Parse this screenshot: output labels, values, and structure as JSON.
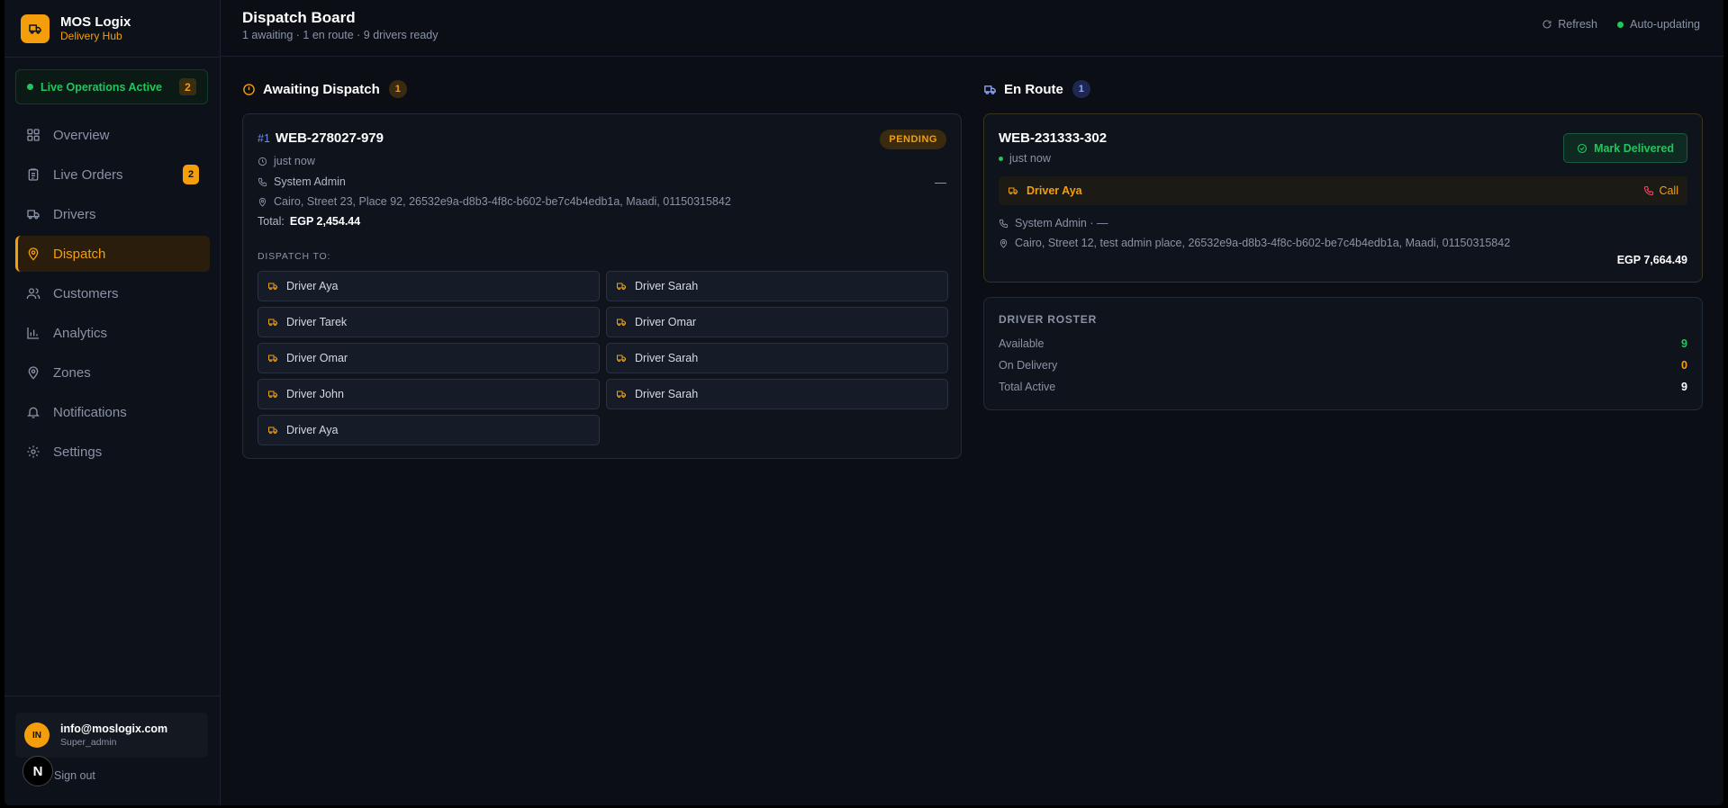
{
  "brand": {
    "name": "MOS Logix",
    "subtitle": "Delivery Hub"
  },
  "live": {
    "label": "Live Operations Active",
    "count": "2"
  },
  "nav": [
    {
      "label": "Overview",
      "icon": "grid-icon"
    },
    {
      "label": "Live Orders",
      "icon": "clipboard-icon",
      "badge": "2"
    },
    {
      "label": "Drivers",
      "icon": "truck-icon"
    },
    {
      "label": "Dispatch",
      "icon": "map-pin-icon",
      "active": true
    },
    {
      "label": "Customers",
      "icon": "users-icon"
    },
    {
      "label": "Analytics",
      "icon": "bar-chart-icon"
    },
    {
      "label": "Zones",
      "icon": "map-pin-icon"
    },
    {
      "label": "Notifications",
      "icon": "bell-icon"
    },
    {
      "label": "Settings",
      "icon": "gear-icon"
    }
  ],
  "user": {
    "initials": "IN",
    "email": "info@moslogix.com",
    "role": "Super_admin",
    "signout": "Sign out"
  },
  "header": {
    "title": "Dispatch Board",
    "subtitle": "1 awaiting · 1 en route · 9 drivers ready",
    "refresh": "Refresh",
    "auto": "Auto-updating"
  },
  "awaiting": {
    "title": "Awaiting Dispatch",
    "count": "1",
    "order": {
      "index": "#1",
      "id": "WEB-278027-979",
      "status": "PENDING",
      "time": "just now",
      "customer": "System Admin",
      "phone_placeholder": "—",
      "address": "Cairo, Street 23, Place 92, 26532e9a-d8b3-4f8c-b602-be7c4b4edb1a, Maadi, 01150315842",
      "total_label": "Total:",
      "total": "EGP 2,454.44",
      "dispatch_label": "DISPATCH TO:",
      "drivers": [
        "Driver Aya",
        "Driver Sarah",
        "Driver Tarek",
        "Driver Omar",
        "Driver Omar",
        "Driver Sarah",
        "Driver John",
        "Driver Sarah",
        "Driver Aya"
      ]
    }
  },
  "enroute": {
    "title": "En Route",
    "count": "1",
    "order": {
      "id": "WEB-231333-302",
      "time": "just now",
      "mark_label": "Mark Delivered",
      "driver": "Driver Aya",
      "call_label": "Call",
      "customer": "System Admin · —",
      "address": "Cairo, Street 12, test admin place, 26532e9a-d8b3-4f8c-b602-be7c4b4edb1a, Maadi, 01150315842",
      "total": "EGP 7,664.49"
    }
  },
  "roster": {
    "title": "DRIVER ROSTER",
    "rows": [
      {
        "label": "Available",
        "value": "9",
        "color": "#22c55e"
      },
      {
        "label": "On Delivery",
        "value": "0",
        "color": "#f59e0b"
      },
      {
        "label": "Total Active",
        "value": "9",
        "color": "#ffffff"
      }
    ]
  },
  "colors": {
    "accent": "#f59e0b",
    "success": "#22c55e",
    "bg": "#0b0e15"
  }
}
